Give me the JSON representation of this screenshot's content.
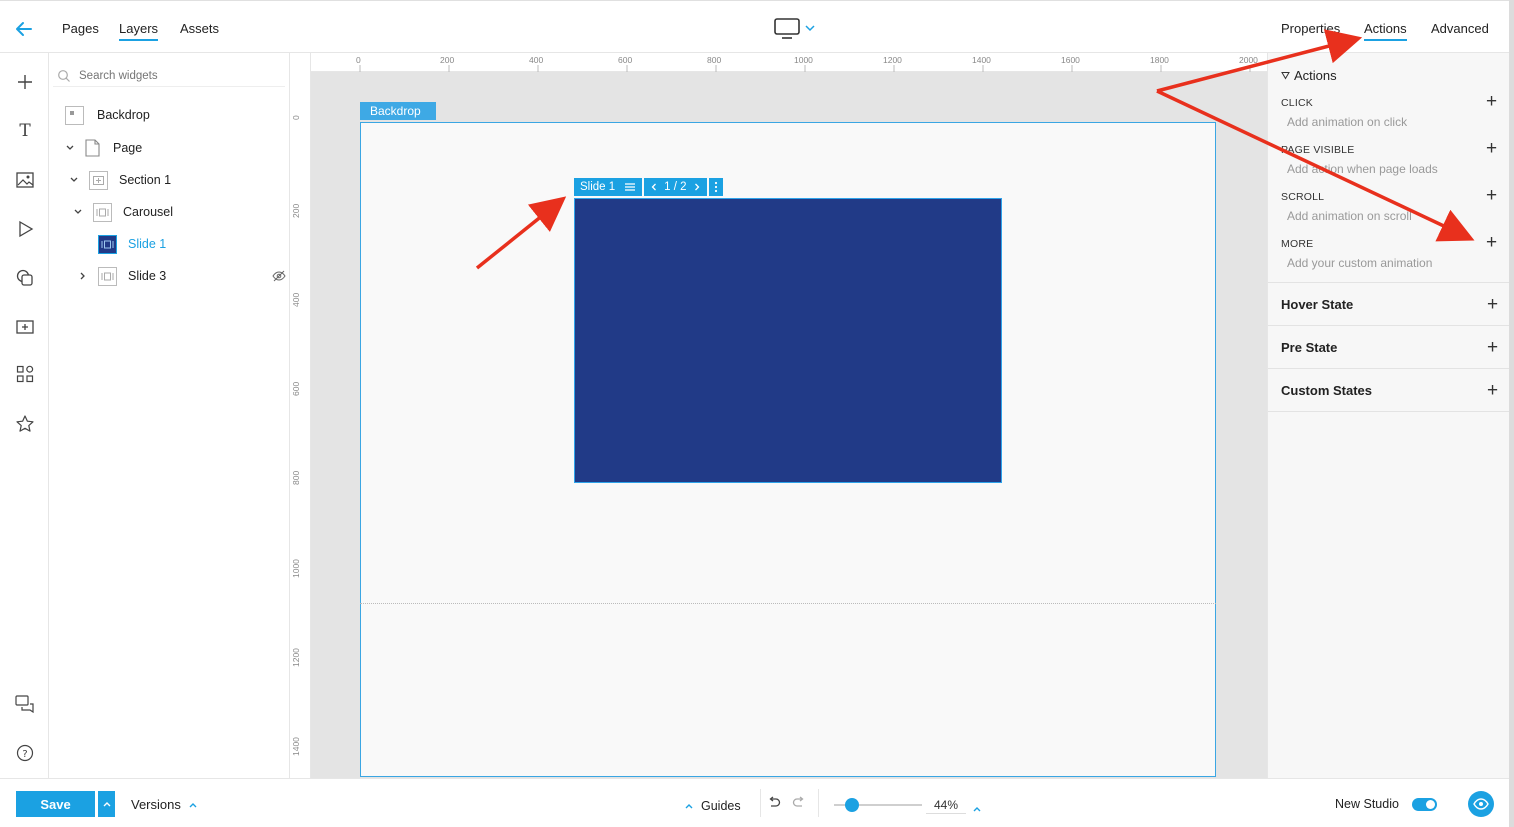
{
  "top_tabs_left": [
    {
      "label": "Pages",
      "active": false
    },
    {
      "label": "Layers",
      "active": true
    },
    {
      "label": "Assets",
      "active": false
    }
  ],
  "top_tabs_right": [
    {
      "label": "Properties",
      "active": false
    },
    {
      "label": "Actions",
      "active": true
    },
    {
      "label": "Advanced",
      "active": false
    }
  ],
  "search": {
    "placeholder": "Search widgets"
  },
  "layers": [
    {
      "label": "Backdrop"
    },
    {
      "label": "Page"
    },
    {
      "label": "Section 1"
    },
    {
      "label": "Carousel"
    },
    {
      "label": "Slide 1",
      "selected": true
    },
    {
      "label": "Slide 3",
      "hidden": true
    }
  ],
  "ruler": {
    "top": [
      "0",
      "200",
      "400",
      "600",
      "800",
      "1000",
      "1200",
      "1400",
      "1600",
      "1800",
      "2000"
    ],
    "left": [
      "0",
      "200",
      "400",
      "600",
      "800",
      "1000",
      "1200",
      "1400"
    ]
  },
  "canvas": {
    "backdrop_label": "Backdrop",
    "slide_label": "Slide 1",
    "pager": "1 / 2",
    "slide_color": "#213a87"
  },
  "actions": {
    "title": "Actions",
    "items": [
      {
        "caption": "CLICK",
        "sub": "Add animation on click"
      },
      {
        "caption": "PAGE VISIBLE",
        "sub": "Add action when page loads"
      },
      {
        "caption": "SCROLL",
        "sub": "Add animation on scroll"
      },
      {
        "caption": "MORE",
        "sub": "Add your custom animation"
      }
    ],
    "states": [
      "Hover State",
      "Pre State",
      "Custom States"
    ]
  },
  "bottom": {
    "save": "Save",
    "versions": "Versions",
    "guides": "Guides",
    "zoom": "44%",
    "zoom_level": 0.15,
    "new_studio": "New Studio",
    "new_studio_on": true
  },
  "colors": {
    "accent": "#1ba1e2",
    "annotation": "#e8301d"
  }
}
